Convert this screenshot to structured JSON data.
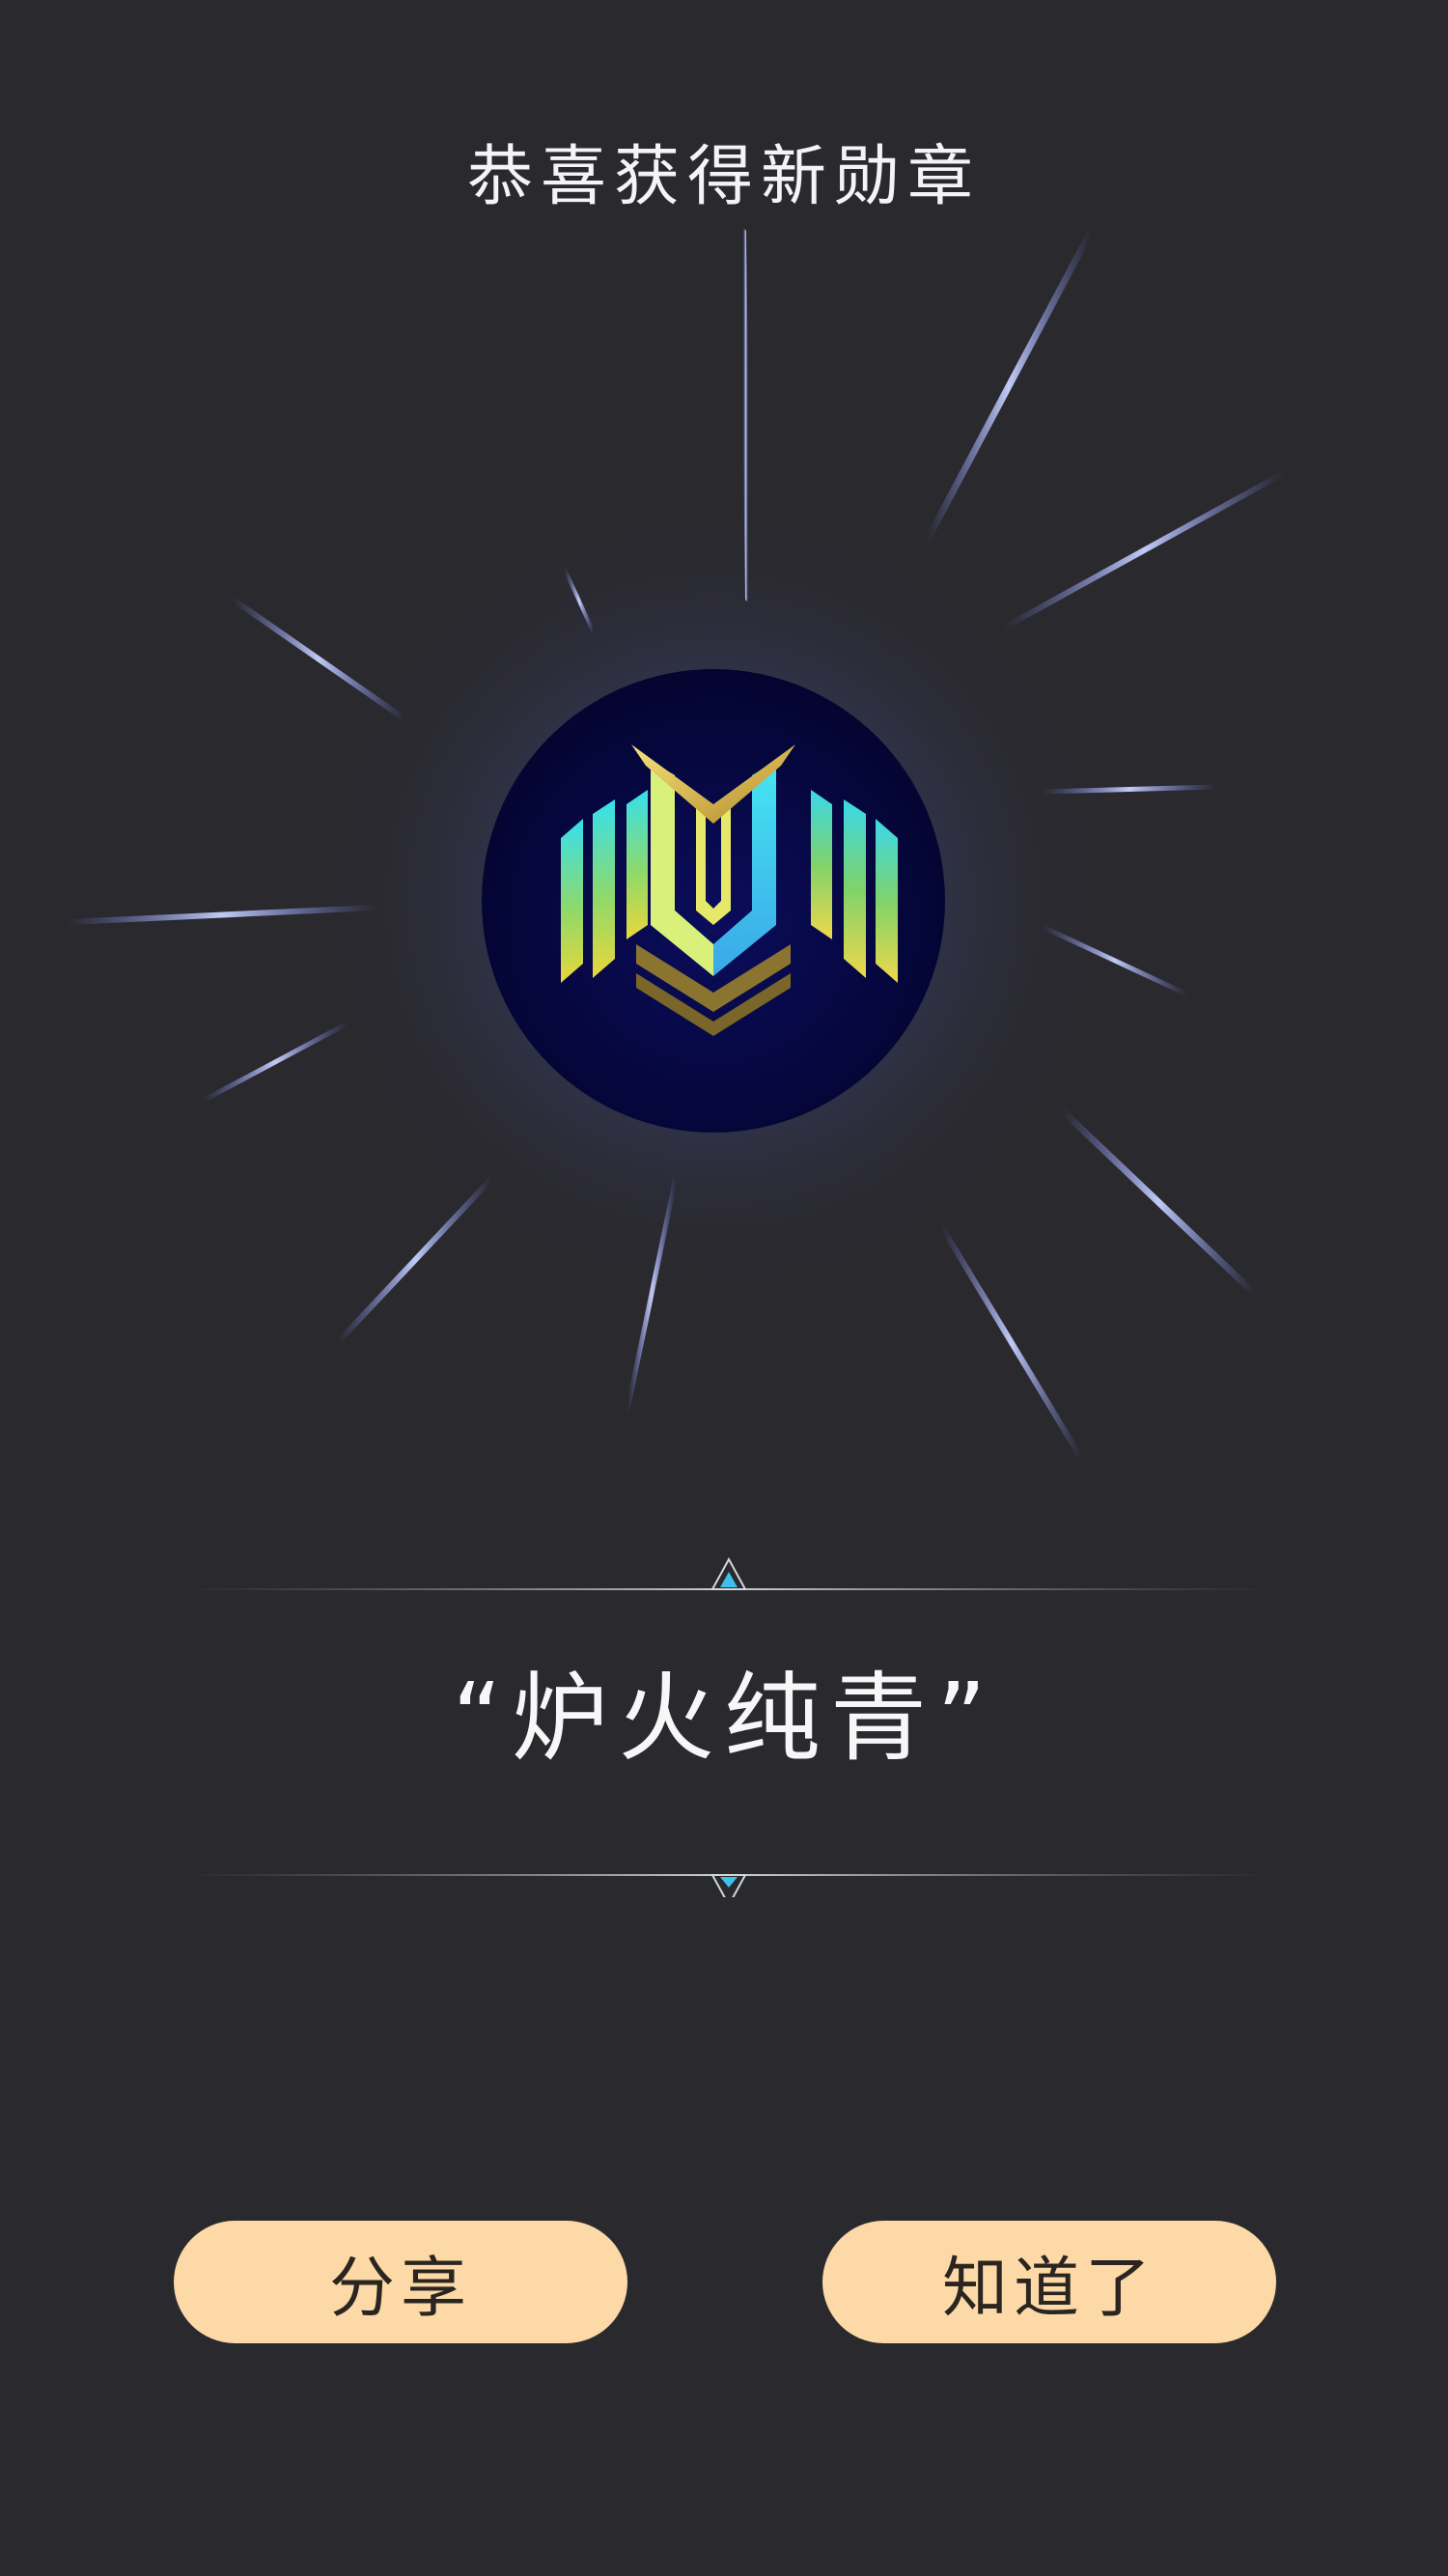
{
  "header": {
    "title": "恭喜获得新勋章"
  },
  "medal": {
    "icon": "medal-emblem-icon",
    "name": "“炉火纯青”"
  },
  "actions": {
    "share_label": "分享",
    "confirm_label": "知道了"
  },
  "colors": {
    "background": "#2a292e",
    "button": "#fdd9a7",
    "medal_disc": "#05063b",
    "glow": "#5b6ce8"
  }
}
